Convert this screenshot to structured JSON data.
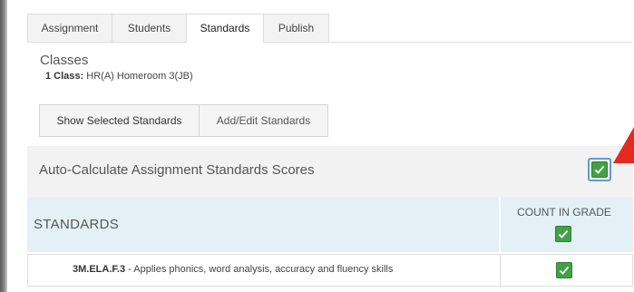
{
  "tabs": [
    {
      "label": "Assignment",
      "active": false
    },
    {
      "label": "Students",
      "active": false
    },
    {
      "label": "Standards",
      "active": true
    },
    {
      "label": "Publish",
      "active": false
    }
  ],
  "classes": {
    "title": "Classes",
    "count_label": "1 Class:",
    "class_name": "HR(A) Homeroom 3(JB)"
  },
  "buttons": {
    "show_selected": "Show Selected Standards",
    "add_edit": "Add/Edit Standards"
  },
  "auto_calculate": {
    "label": "Auto-Calculate Assignment Standards Scores",
    "checked": true
  },
  "standards_table": {
    "header": "STANDARDS",
    "count_header": "COUNT IN GRADE",
    "count_header_checked": true,
    "rows": [
      {
        "code": "3M.ELA.F.3",
        "description": " - Applies phonics, word analysis, accuracy and fluency skills",
        "count_in_grade": true
      }
    ]
  },
  "colors": {
    "check_green": "#43a047",
    "focus_blue": "#5b9bd5",
    "header_bg": "#e3f1f7",
    "arrow_red": "#e52b1f"
  },
  "icons": {
    "checkbox": "check-icon",
    "annotation": "red-arrow-icon"
  }
}
